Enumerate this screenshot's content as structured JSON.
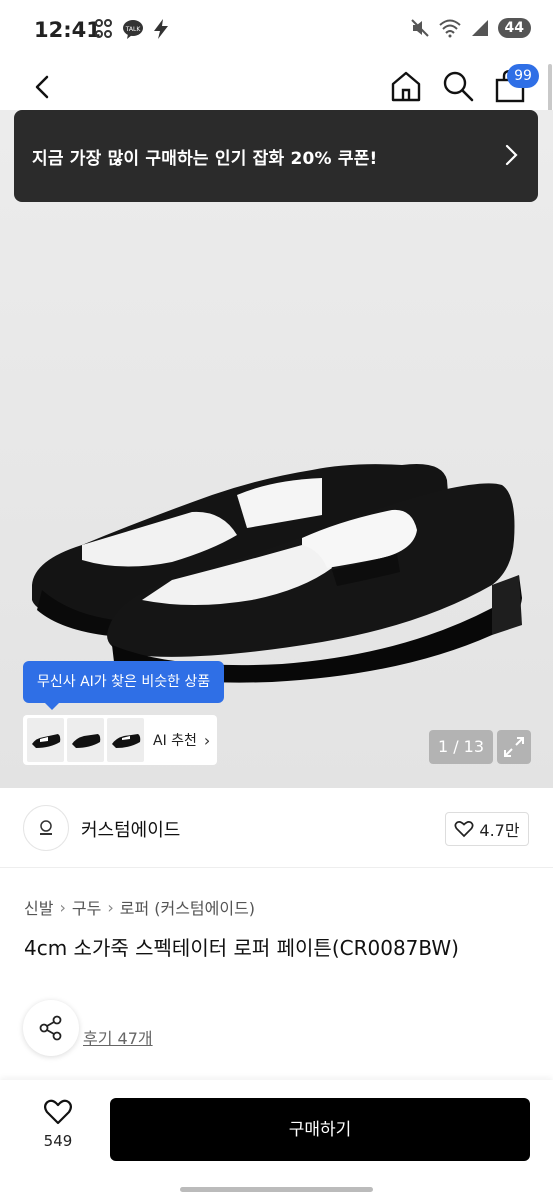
{
  "status_bar": {
    "time": "12:41",
    "battery": "44",
    "left_icons": [
      "quota-icon",
      "kakaotalk-icon",
      "bolt-icon"
    ],
    "right_icons": [
      "mute-icon",
      "wifi-icon",
      "signal-icon"
    ]
  },
  "nav": {
    "cart_badge": "99"
  },
  "coupon": {
    "text": "지금 가장 많이 구매하는 인기 잡화 20% 쿠폰!"
  },
  "ai_recommend": {
    "tag": "무신사 AI가 찾은 비슷한 상품",
    "label": "AI 추천"
  },
  "gallery": {
    "counter": "1 / 13"
  },
  "brand": {
    "name": "커스텀에이드",
    "likes": "4.7만"
  },
  "breadcrumb": [
    "신발",
    "구두",
    "로퍼 (커스텀에이드)"
  ],
  "product": {
    "title": "4cm 소가죽 스펙테이터 로퍼 페이튼(CR0087BW)",
    "reviews": "후기 47개"
  },
  "bottom": {
    "wish_count": "549",
    "buy_label": "구매하기"
  },
  "colors": {
    "accent": "#2f6fe6",
    "banner_bg": "#2b2b2b",
    "buy_button": "#000000"
  }
}
